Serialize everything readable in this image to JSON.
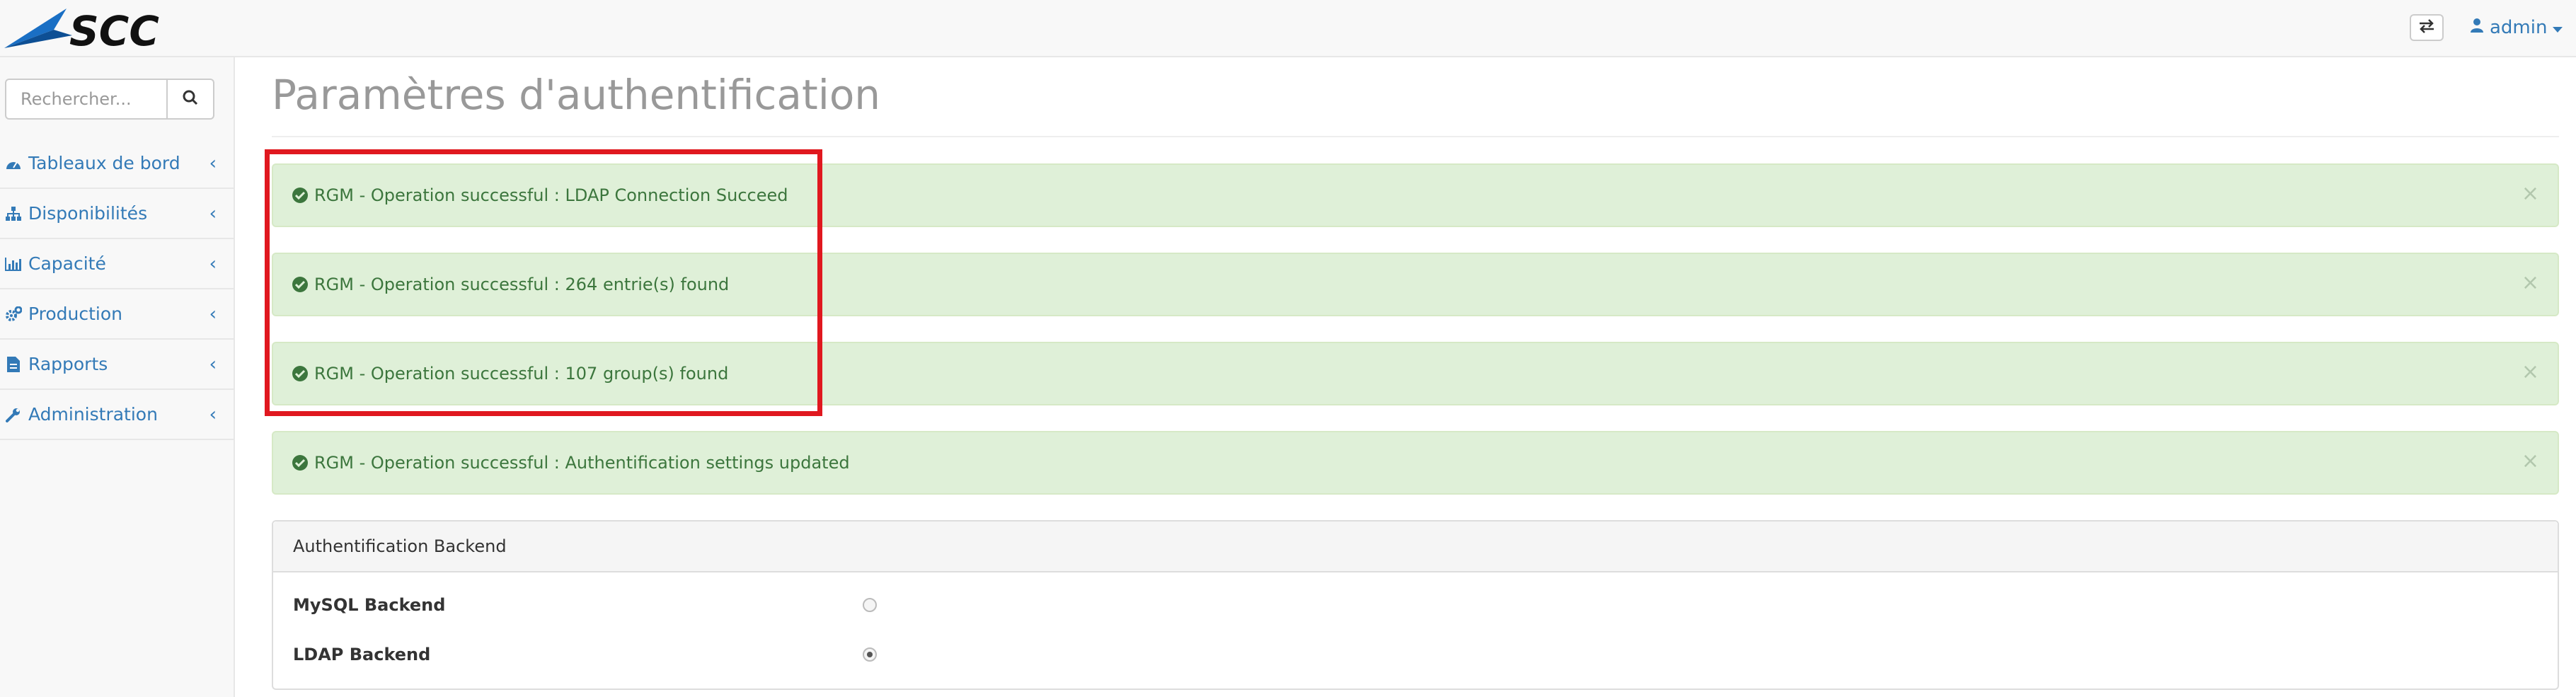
{
  "header": {
    "logo_text": "SCC",
    "user_label": "admin"
  },
  "sidebar": {
    "search_placeholder": "Rechercher...",
    "items": [
      {
        "label": "Tableaux de bord",
        "icon": "dashboard-icon"
      },
      {
        "label": "Disponibilités",
        "icon": "sitemap-icon"
      },
      {
        "label": "Capacité",
        "icon": "bar-chart-icon"
      },
      {
        "label": "Production",
        "icon": "gears-icon"
      },
      {
        "label": "Rapports",
        "icon": "file-icon"
      },
      {
        "label": "Administration",
        "icon": "wrench-icon"
      }
    ]
  },
  "main": {
    "title": "Paramètres d'authentification",
    "alerts": [
      {
        "text": "RGM - Operation successful : LDAP Connection Succeed",
        "close": "×"
      },
      {
        "text": "RGM - Operation successful : 264 entrie(s) found",
        "close": "×"
      },
      {
        "text": "RGM - Operation successful : 107 group(s) found",
        "close": "×"
      },
      {
        "text": "RGM - Operation successful : Authentification settings updated",
        "close": "×"
      }
    ],
    "panel": {
      "heading": "Authentification Backend",
      "options": [
        {
          "label": "MySQL Backend",
          "checked": false
        },
        {
          "label": "LDAP Backend",
          "checked": true
        }
      ]
    }
  },
  "colors": {
    "link": "#337ab7",
    "alert_bg": "#dff0d8",
    "alert_text": "#3c763d",
    "highlight": "#e0181f",
    "logo_blue": "#1a6fc4"
  }
}
